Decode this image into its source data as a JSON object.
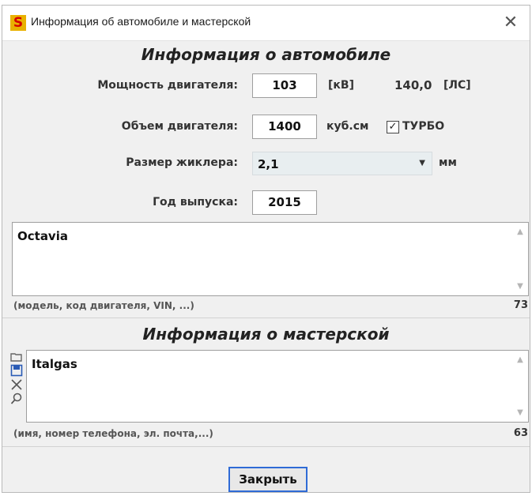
{
  "window": {
    "title": "Информация об автомобиле и мастерской",
    "close_symbol": "✕"
  },
  "car": {
    "header": "Информация о автомобиле",
    "power": {
      "label": "Мощность двигателя:",
      "value": "103",
      "unit": "[кВ]",
      "hp_value": "140,0",
      "hp_unit": "[ЛС]"
    },
    "displacement": {
      "label": "Объем двигателя:",
      "value": "1400",
      "unit": "куб.см",
      "turbo_checked": true,
      "turbo_label": "ТУРБО"
    },
    "jet": {
      "label": "Размер жиклера:",
      "value": "2,1",
      "unit": "мм"
    },
    "year": {
      "label": "Год выпуска:",
      "value": "2015"
    },
    "notes": {
      "value": "Octavia",
      "hint": "(модель, код двигателя, VIN, ...)",
      "counter": "73"
    }
  },
  "workshop": {
    "header": "Информация о мастерской",
    "notes": {
      "value": "Italgas",
      "hint": "(имя, номер телефона, эл. почта,...)",
      "counter": "63"
    },
    "icons": [
      "open-icon",
      "save-icon",
      "delete-icon",
      "search-icon"
    ]
  },
  "footer": {
    "close_label": "Закрыть"
  },
  "colors": {
    "accent_border": "#2f6bd6",
    "app_icon_bg": "#e9b100",
    "app_icon_fg": "#d40000"
  }
}
